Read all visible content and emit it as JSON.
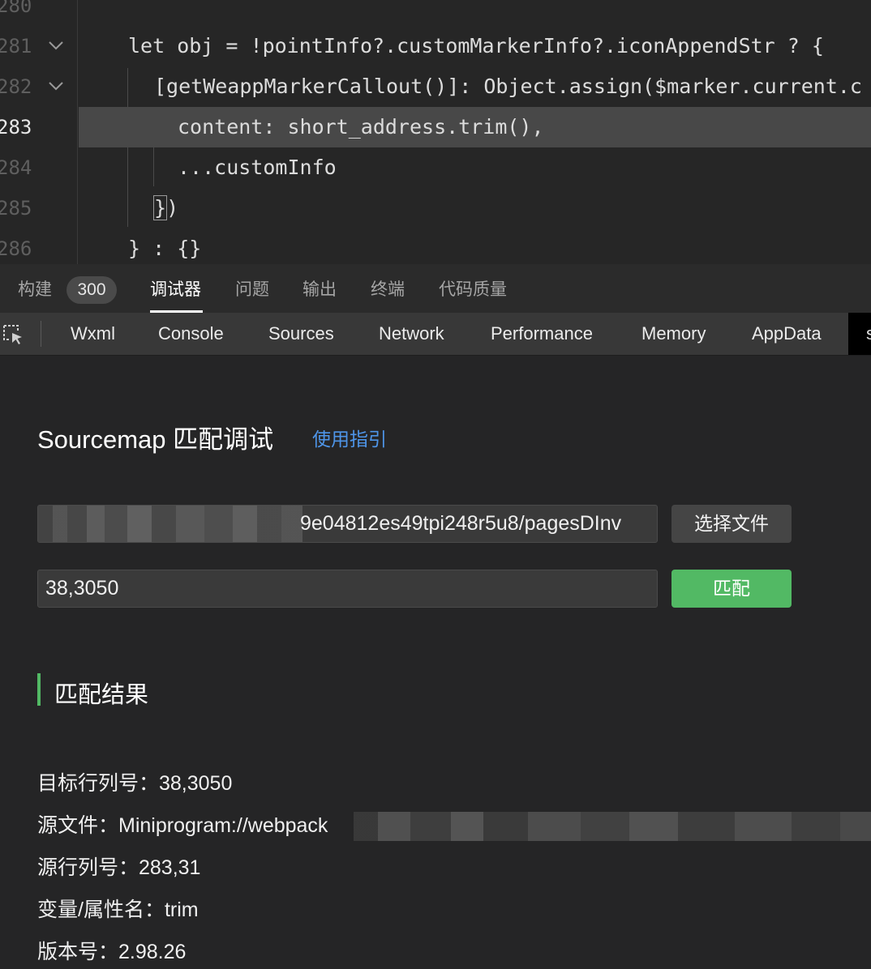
{
  "editor": {
    "lines": [
      {
        "num": "280",
        "text": ""
      },
      {
        "num": "281",
        "text": "let obj = !pointInfo?.customMarkerInfo?.iconAppendStr ? {"
      },
      {
        "num": "282",
        "text": "[getWeappMarkerCallout()]: Object.assign($marker.current.c"
      },
      {
        "num": "283",
        "text": "content: short_address.trim(),"
      },
      {
        "num": "284",
        "text": "...customInfo"
      },
      {
        "num": "285",
        "text_box": "}",
        "text_rest": ")"
      },
      {
        "num": "286",
        "text": "} : {}"
      }
    ],
    "fold_icon": "chevron-down-icon"
  },
  "panel_tabs": {
    "build": "构建",
    "build_badge": "300",
    "debugger": "调试器",
    "problems": "问题",
    "output": "输出",
    "terminal": "终端",
    "code_quality": "代码质量"
  },
  "devtools_tabs": {
    "inspect_icon": "cursor-select-icon",
    "wxml": "Wxml",
    "console": "Console",
    "sources": "Sources",
    "network": "Network",
    "performance": "Performance",
    "memory": "Memory",
    "appdata": "AppData",
    "overflow": "s"
  },
  "sourcemap": {
    "title": "Sourcemap 匹配调试",
    "guide_link": "使用指引",
    "file_path_visible": "9e04812es49tpi248r5u8/pagesDInv",
    "choose_file_label": "选择文件",
    "position_value": "38,3050",
    "match_label": "匹配",
    "result_title": "匹配结果",
    "results": {
      "target_pos": "目标行列号：38,3050",
      "source_file": "源文件：Miniprogram://webpack",
      "source_pos": "源行列号：283,31",
      "var_name": "变量/属性名：trim",
      "version": "版本号：2.98.26"
    }
  },
  "colors": {
    "accent_green": "#52b964",
    "link_blue": "#4e95e8"
  }
}
